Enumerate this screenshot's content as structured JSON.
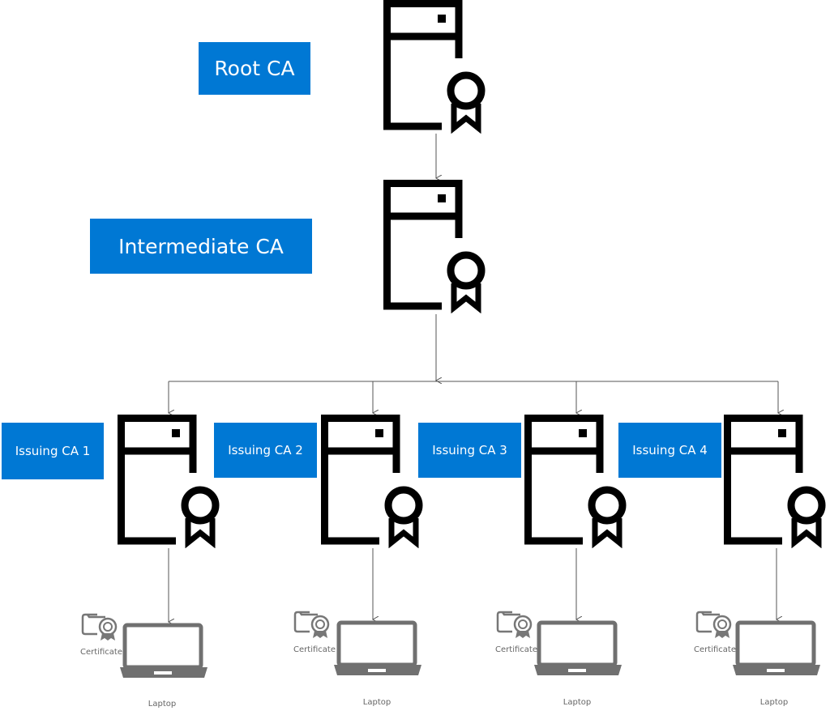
{
  "colors": {
    "label_bg": "#0078d4",
    "label_text": "#ffffff",
    "server": "#000000",
    "device": "#707070",
    "connector": "#555555"
  },
  "root": {
    "label": "Root CA",
    "icon": "server-certificate-icon"
  },
  "intermediate": {
    "label": "Intermediate CA",
    "icon": "server-certificate-icon"
  },
  "issuing": [
    {
      "label": "Issuing CA 1"
    },
    {
      "label": "Issuing CA 2"
    },
    {
      "label": "Issuing CA 3"
    },
    {
      "label": "Issuing CA 4"
    }
  ],
  "endpoints": [
    {
      "cert_label": "Certificate",
      "device_label": "Laptop"
    },
    {
      "cert_label": "Certificate",
      "device_label": "Laptop"
    },
    {
      "cert_label": "Certificate",
      "device_label": "Laptop"
    },
    {
      "cert_label": "Certificate",
      "device_label": "Laptop"
    }
  ]
}
